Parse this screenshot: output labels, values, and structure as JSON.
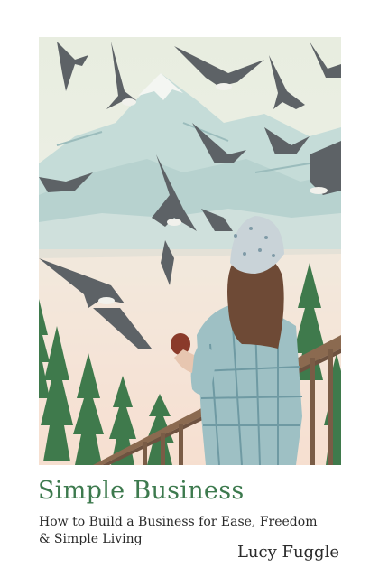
{
  "book": {
    "title": "Simple Business",
    "subtitle": "How to Build a Business for Ease, Freedom & Simple Living",
    "author": "Lucy Fuggle"
  },
  "colors": {
    "title": "#3d7a4e",
    "text": "#2a2a2a",
    "sky": "#e9eee0",
    "mountain": "#b9d3d1",
    "tree": "#3f7a4c",
    "railing": "#8b6a50",
    "sweater": "#9ec0c4",
    "hat": "#c9d3d8",
    "hair": "#6e4a36",
    "bird": "#5d6266"
  }
}
